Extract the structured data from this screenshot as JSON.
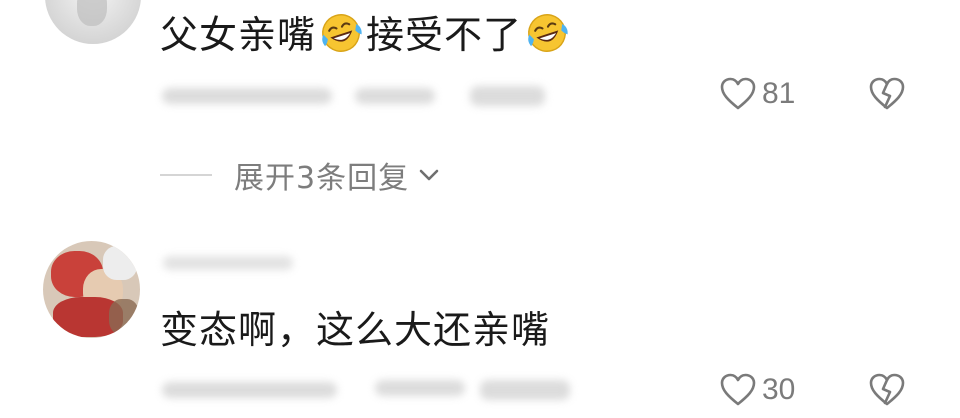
{
  "comments": [
    {
      "text_before_emoji": "父女亲嘴",
      "text_middle": "接受不了",
      "emoji_icon": "rofl-emoji-icon",
      "likes": "81"
    },
    {
      "text": "变态啊，这么大还亲嘴",
      "likes": "30"
    }
  ],
  "expand_replies": {
    "label": "展开3条回复",
    "icon": "chevron-down-icon"
  },
  "colors": {
    "text": "#1a1a1a",
    "muted": "#7b7b7b",
    "icon_stroke": "#7a7a7a",
    "emoji_face": "#f7c531"
  }
}
